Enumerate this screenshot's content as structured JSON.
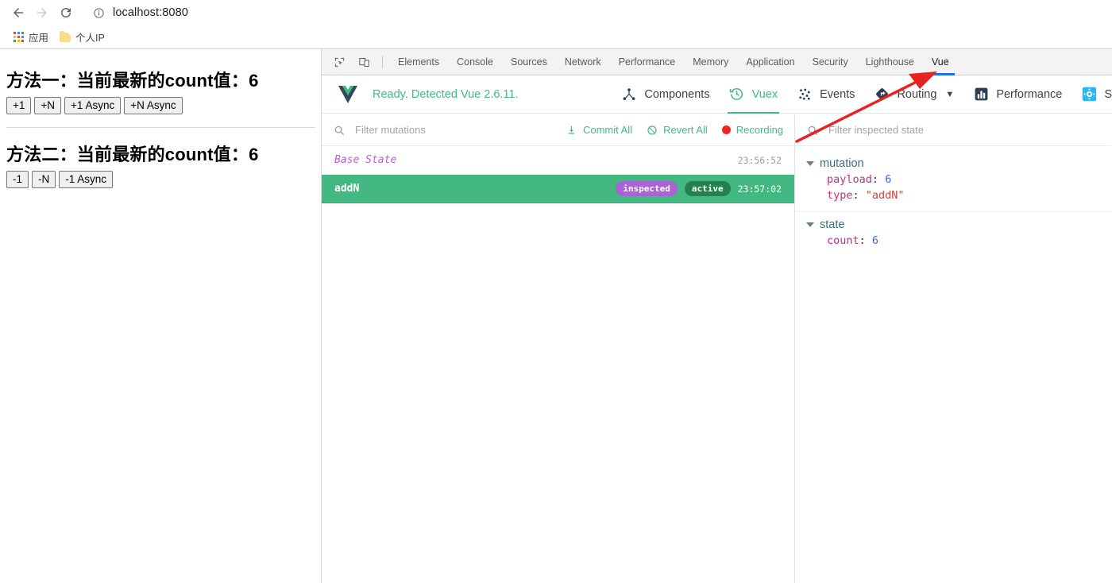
{
  "browser": {
    "back_icon": "back-arrow-icon",
    "forward_icon": "forward-arrow-icon",
    "reload_icon": "reload-icon",
    "info_icon": "page-info-icon",
    "url": "localhost:8080",
    "bookmarks": [
      {
        "label": "应用",
        "icon": "apps-grid-icon"
      },
      {
        "label": "个人IP",
        "icon": "folder-icon"
      }
    ]
  },
  "page": {
    "section_one": {
      "heading": "方法一：当前最新的count值：6",
      "buttons": [
        "+1",
        "+N",
        "+1 Async",
        "+N Async"
      ]
    },
    "section_two": {
      "heading": "方法二：当前最新的count值：6",
      "buttons": [
        "-1",
        "-N",
        "-1 Async"
      ]
    }
  },
  "devtools": {
    "inspect_icon": "inspect-element-icon",
    "device_icon": "device-toolbar-icon",
    "tabs": [
      {
        "label": "Elements",
        "active": false
      },
      {
        "label": "Console",
        "active": false
      },
      {
        "label": "Sources",
        "active": false
      },
      {
        "label": "Network",
        "active": false
      },
      {
        "label": "Performance",
        "active": false
      },
      {
        "label": "Memory",
        "active": false
      },
      {
        "label": "Application",
        "active": false
      },
      {
        "label": "Security",
        "active": false
      },
      {
        "label": "Lighthouse",
        "active": false
      },
      {
        "label": "Vue",
        "active": true
      }
    ],
    "active_tab_color": "#1a73e8"
  },
  "vue_devtools": {
    "logo_icon": "vue-logo-icon",
    "status": "Ready. Detected Vue 2.6.11.",
    "status_color": "#42b983",
    "tabs": [
      {
        "label": "Components",
        "icon": "component-tree-icon",
        "active": false,
        "has_chevron": false
      },
      {
        "label": "Vuex",
        "icon": "history-clock-icon",
        "active": true,
        "has_chevron": false
      },
      {
        "label": "Events",
        "icon": "events-dots-icon",
        "active": false,
        "has_chevron": false
      },
      {
        "label": "Routing",
        "icon": "routing-arrow-icon",
        "active": false,
        "has_chevron": true
      },
      {
        "label": "Performance",
        "icon": "bar-chart-icon",
        "active": false,
        "has_chevron": false
      },
      {
        "label": "S",
        "icon": "settings-gear-icon",
        "active": false,
        "has_chevron": false
      }
    ],
    "mutations_pane": {
      "search_icon": "search-icon",
      "filter_placeholder": "Filter mutations",
      "actions": [
        {
          "label": "Commit All",
          "icon": "download-commit-icon"
        },
        {
          "label": "Revert All",
          "icon": "revert-circle-slash-icon"
        },
        {
          "label": "Recording",
          "icon": "record-dot-icon"
        }
      ],
      "rows": [
        {
          "name": "Base State",
          "time": "23:56:52",
          "selected": false,
          "is_base": true,
          "badges": []
        },
        {
          "name": "addN",
          "time": "23:57:02",
          "selected": true,
          "is_base": false,
          "badges": [
            "inspected",
            "active"
          ]
        }
      ]
    },
    "inspector_pane": {
      "search_icon": "search-icon",
      "filter_placeholder": "Filter inspected state",
      "groups": [
        {
          "title": "mutation",
          "entries": [
            {
              "key": "payload",
              "value": "6",
              "value_type": "number"
            },
            {
              "key": "type",
              "value": "\"addN\"",
              "value_type": "string"
            }
          ]
        },
        {
          "title": "state",
          "entries": [
            {
              "key": "count",
              "value": "6",
              "value_type": "number"
            }
          ]
        }
      ]
    }
  },
  "annotation": {
    "arrow_color": "#e8231f",
    "name": "red-annotation-arrow"
  }
}
